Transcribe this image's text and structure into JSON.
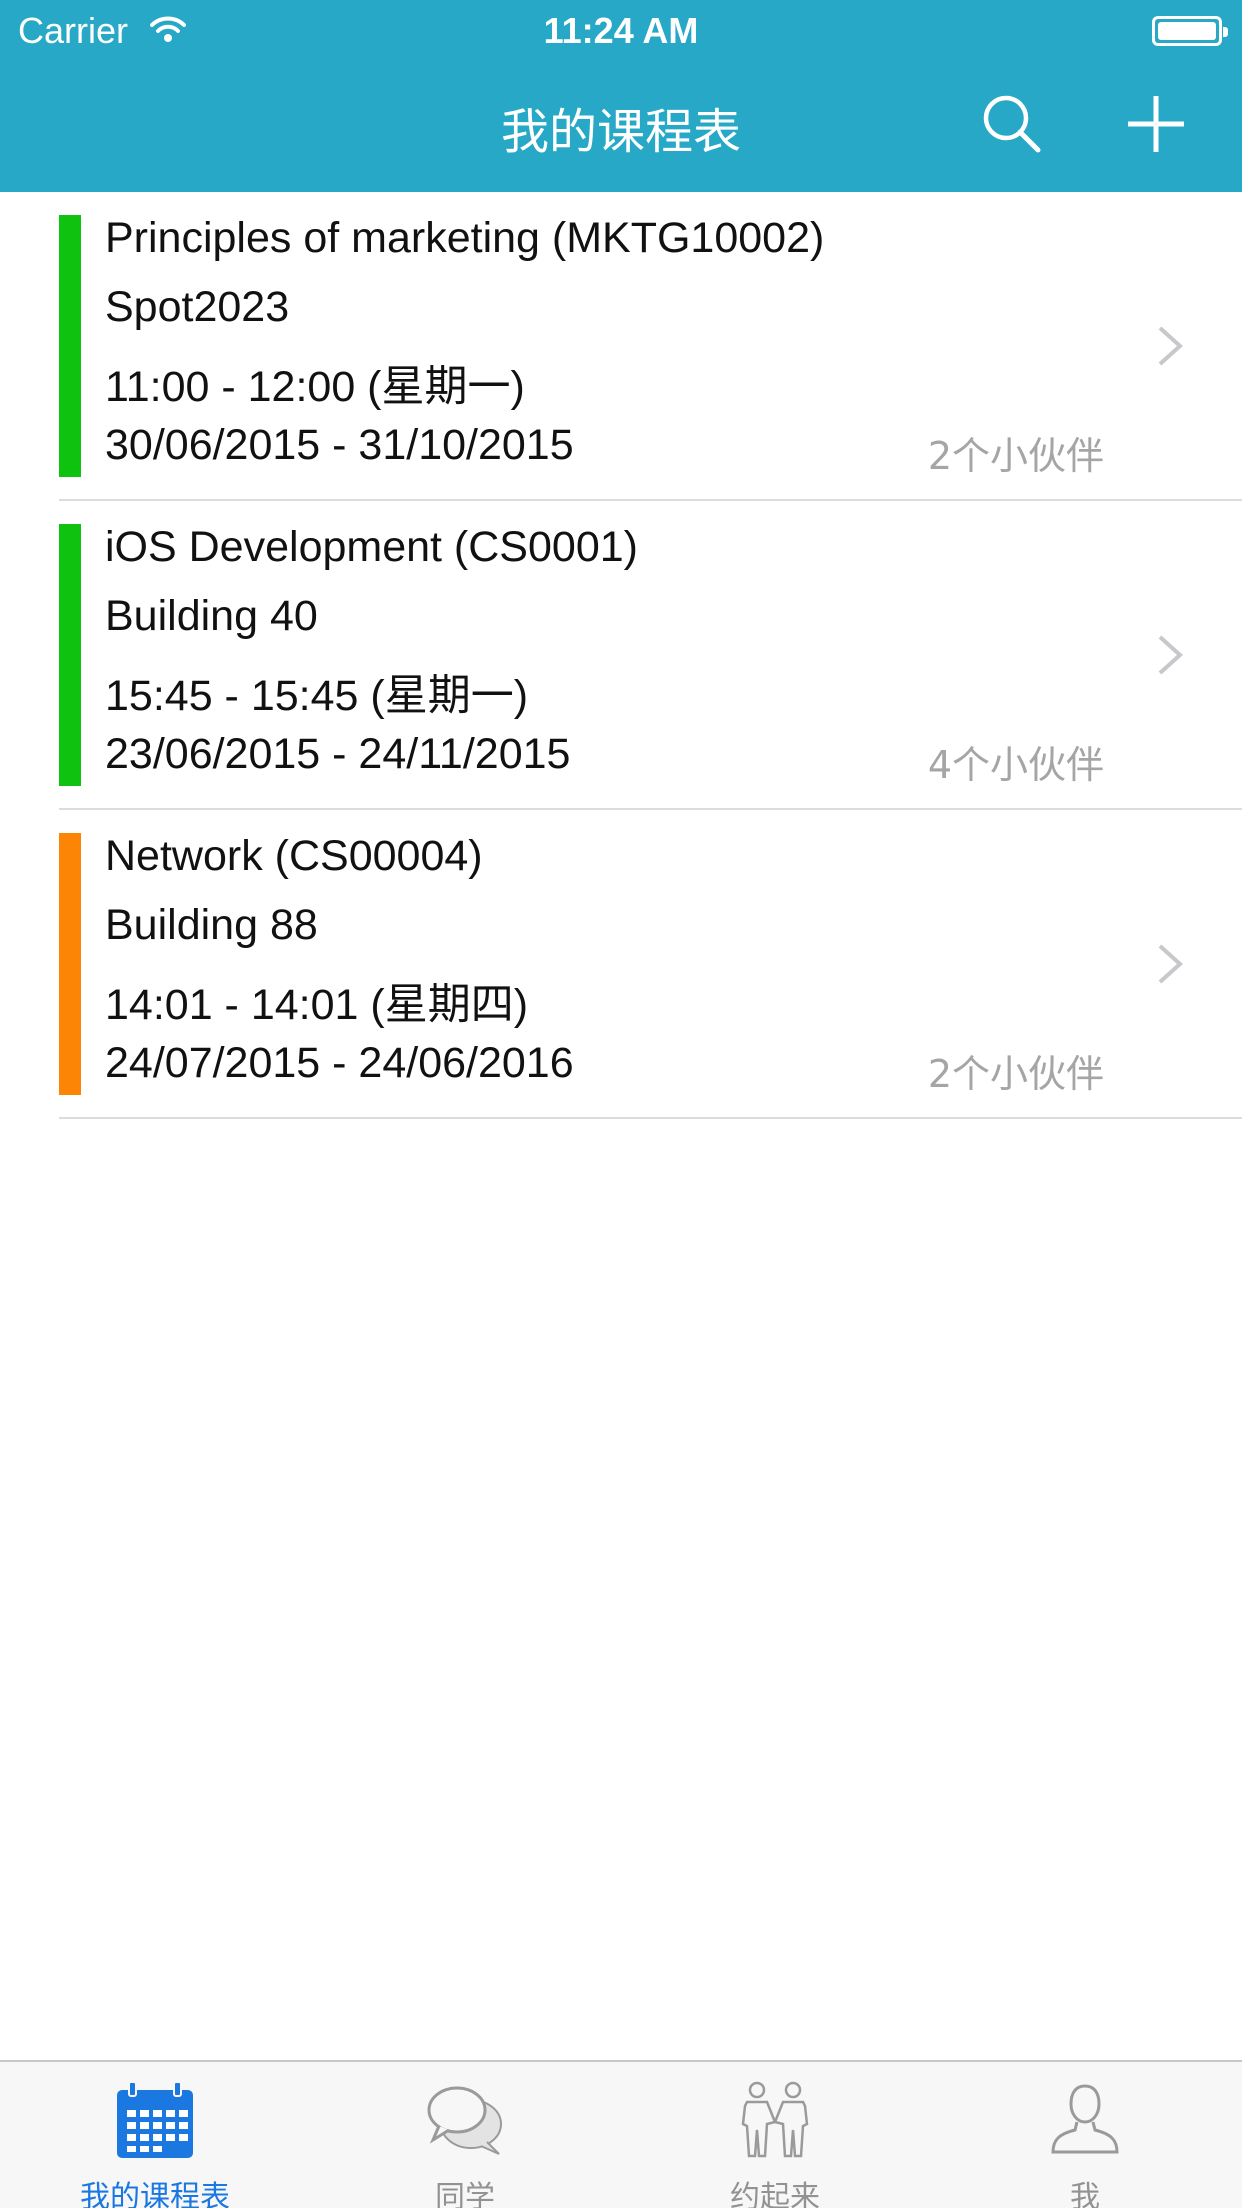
{
  "status_bar": {
    "carrier": "Carrier",
    "time": "11:24 AM"
  },
  "nav": {
    "title": "我的课程表"
  },
  "colors": {
    "nav": "#27a8c6",
    "green": "#0fc20f",
    "orange": "#fd8506",
    "active_tab": "#1a78e0"
  },
  "courses": [
    {
      "title": "Principles of marketing (MKTG10002)",
      "location": "Spot2023",
      "time": "11:00 - 12:00 (星期一)",
      "dates": "30/06/2015 - 31/10/2015",
      "friends": "2个小伙伴",
      "color": "#0fc20f"
    },
    {
      "title": "iOS Development (CS0001)",
      "location": "Building 40",
      "time": "15:45 - 15:45 (星期一)",
      "dates": "23/06/2015 - 24/11/2015",
      "friends": "4个小伙伴",
      "color": "#0fc20f"
    },
    {
      "title": "Network (CS00004)",
      "location": "Building 88",
      "time": "14:01 - 14:01 (星期四)",
      "dates": "24/07/2015 - 24/06/2016",
      "friends": "2个小伙伴",
      "color": "#fd8506"
    }
  ],
  "tabs": [
    {
      "label": "我的课程表",
      "icon": "calendar-icon"
    },
    {
      "label": "同学",
      "icon": "chat-bubbles-icon"
    },
    {
      "label": "约起来",
      "icon": "people-handshake-icon"
    },
    {
      "label": "我",
      "icon": "person-icon"
    }
  ]
}
